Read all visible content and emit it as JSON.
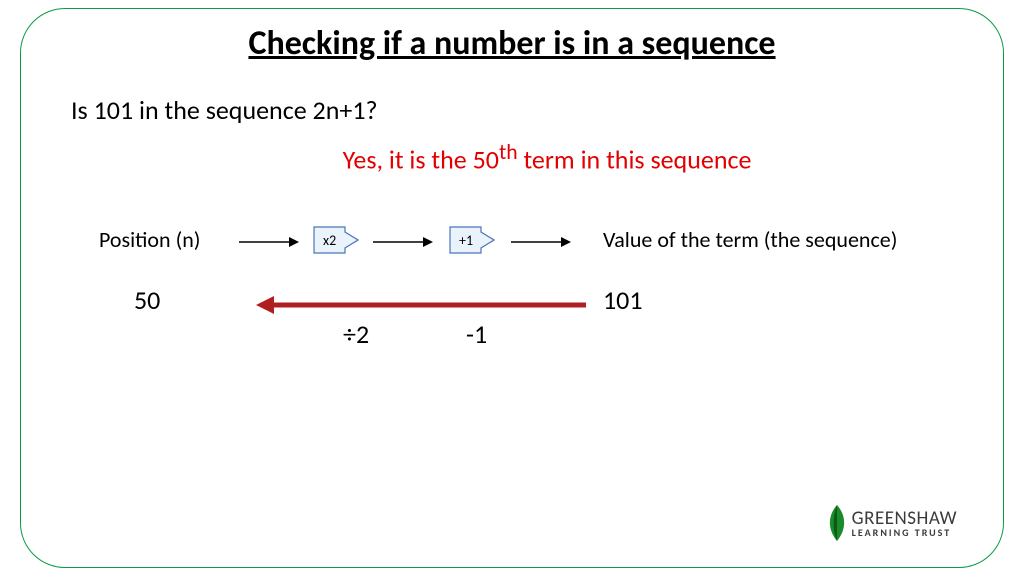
{
  "title": "Checking if a number is in a sequence",
  "question": "Is 101 in the sequence 2n+1?",
  "answer_pre": "Yes, it is the 50",
  "answer_sup": "th",
  "answer_post": " term in this sequence",
  "label_position": "Position (n)",
  "label_value": "Value of the term (the sequence)",
  "op_x2": "x2",
  "op_plus1": "+1",
  "reverse_start": "50",
  "reverse_end": "101",
  "reverse_div": "÷2",
  "reverse_minus": "-1",
  "logo_main": "GREENSHAW",
  "logo_sub": "LEARNING TRUST"
}
